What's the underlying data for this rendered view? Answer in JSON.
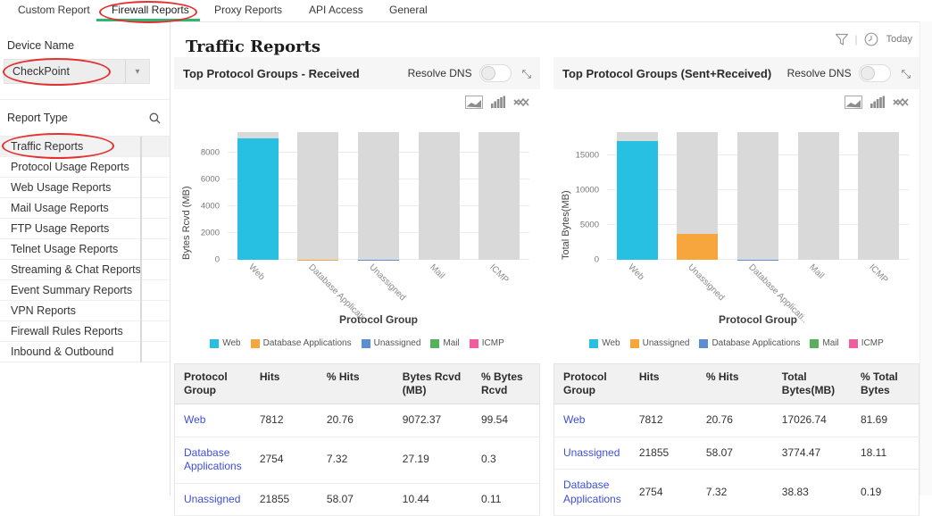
{
  "tabs": {
    "items": [
      {
        "label": "Custom Report",
        "active": false
      },
      {
        "label": "Firewall Reports",
        "active": true
      },
      {
        "label": "Proxy Reports",
        "active": false
      },
      {
        "label": "API Access",
        "active": false
      },
      {
        "label": "General",
        "active": false
      }
    ]
  },
  "sidebar": {
    "device_name_label": "Device Name",
    "device_select": {
      "value": "CheckPoint"
    },
    "report_type_label": "Report Type",
    "items": [
      {
        "label": "Traffic Reports",
        "selected": true
      },
      {
        "label": "Protocol Usage Reports",
        "selected": false
      },
      {
        "label": "Web Usage Reports",
        "selected": false
      },
      {
        "label": "Mail Usage Reports",
        "selected": false
      },
      {
        "label": "FTP Usage Reports",
        "selected": false
      },
      {
        "label": "Telnet Usage Reports",
        "selected": false
      },
      {
        "label": "Streaming & Chat Reports",
        "selected": false
      },
      {
        "label": "Event Summary Reports",
        "selected": false
      },
      {
        "label": "VPN Reports",
        "selected": false
      },
      {
        "label": "Firewall Rules Reports",
        "selected": false
      },
      {
        "label": "Inbound & Outbound",
        "selected": false
      }
    ]
  },
  "header": {
    "title": "Traffic Reports",
    "today_label": "Today"
  },
  "panels": [
    {
      "title": "Top Protocol Groups - Received",
      "resolve_dns_label": "Resolve DNS",
      "toggle_on": false,
      "table": {
        "headers": [
          "Protocol Group",
          "Hits",
          "% Hits",
          "Bytes Rcvd (MB)",
          "% Bytes Rcvd"
        ],
        "rows": [
          [
            "Web",
            "7812",
            "20.76",
            "9072.37",
            "99.54"
          ],
          [
            "Database Applications",
            "2754",
            "7.32",
            "27.19",
            "0.3"
          ],
          [
            "Unassigned",
            "21855",
            "58.07",
            "10.44",
            "0.11"
          ]
        ]
      }
    },
    {
      "title": "Top Protocol Groups (Sent+Received)",
      "resolve_dns_label": "Resolve DNS",
      "toggle_on": false,
      "table": {
        "headers": [
          "Protocol Group",
          "Hits",
          "% Hits",
          "Total Bytes(MB)",
          "% Total Bytes"
        ],
        "rows": [
          [
            "Web",
            "7812",
            "20.76",
            "17026.74",
            "81.69"
          ],
          [
            "Unassigned",
            "21855",
            "58.07",
            "3774.47",
            "18.11"
          ],
          [
            "Database Applications",
            "2754",
            "7.32",
            "38.83",
            "0.19"
          ]
        ]
      }
    }
  ],
  "chart_data": [
    {
      "type": "bar",
      "title": "Top Protocol Groups - Received",
      "categories": [
        "Web",
        "Database Applicati..",
        "Unassigned",
        "Mail",
        "ICMP"
      ],
      "values": [
        9072.37,
        27.19,
        10.44,
        0,
        0
      ],
      "xlabel": "Protocol Group",
      "ylabel": "Bytes Rcvd (MB)",
      "ylim": [
        0,
        9550
      ],
      "yticks": [
        0,
        2000,
        4000,
        6000,
        8000
      ],
      "legend": [
        "Web",
        "Database Applications",
        "Unassigned",
        "Mail",
        "ICMP"
      ],
      "legend_position": "bottom",
      "grid": true
    },
    {
      "type": "bar",
      "title": "Top Protocol Groups (Sent+Received)",
      "categories": [
        "Web",
        "Unassigned",
        "Database Applicati..",
        "Mail",
        "ICMP"
      ],
      "values": [
        17026.74,
        3774.47,
        38.83,
        0,
        0
      ],
      "xlabel": "Protocol Group",
      "ylabel": "Total Bytes(MB)",
      "ylim": [
        0,
        18300
      ],
      "yticks": [
        0,
        5000,
        10000,
        15000
      ],
      "legend": [
        "Web",
        "Unassigned",
        "Database Applications",
        "Mail",
        "ICMP"
      ],
      "legend_position": "bottom",
      "grid": true
    }
  ],
  "colors": {
    "series": [
      "#27c0e3",
      "#f7a63d",
      "#5b8fd0",
      "#57b15b",
      "#ef5f9e"
    ],
    "bar_track": "#d9d9d9",
    "accent_green": "#2eb673",
    "annotation_red": "#e43030",
    "link_blue": "#3e4fd8"
  }
}
